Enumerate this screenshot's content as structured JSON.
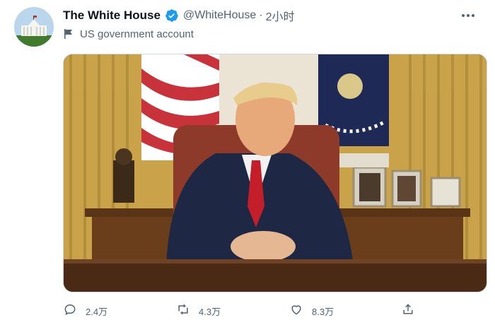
{
  "tweet": {
    "display_name": "The White House",
    "handle": "@WhiteHouse",
    "separator": "·",
    "time": "2小时",
    "account_label": "US government account"
  },
  "icons": {
    "avatar": "white-house-avatar",
    "verified": "verified-badge-icon",
    "more": "more-options-icon",
    "label": "flag-icon",
    "reply": "reply-icon",
    "retweet": "retweet-icon",
    "like": "heart-icon",
    "share": "share-icon"
  },
  "actions": {
    "reply_count": "2.4万",
    "retweet_count": "4.3万",
    "like_count": "8.3万"
  },
  "colors": {
    "verified": "#1d9bf0",
    "text_secondary": "#536471",
    "text_primary": "#0f1419"
  }
}
